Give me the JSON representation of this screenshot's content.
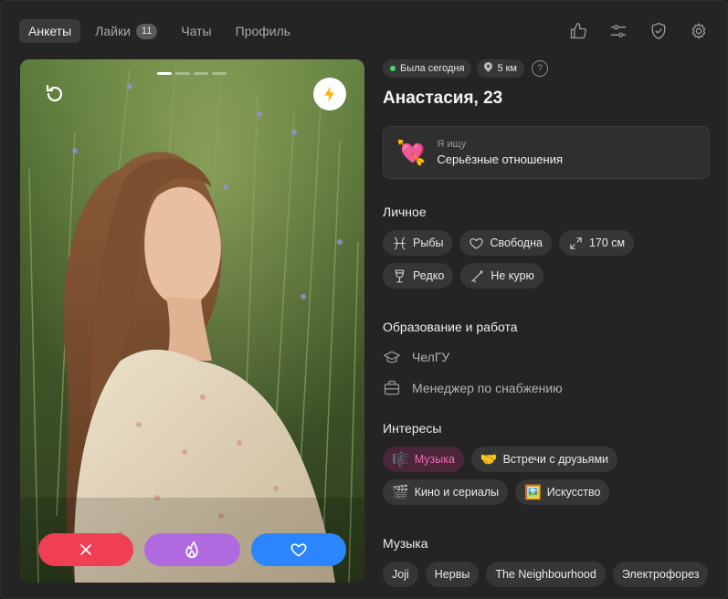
{
  "nav": {
    "tabs": [
      {
        "label": "Анкеты",
        "active": true
      },
      {
        "label": "Лайки",
        "badge": "11"
      },
      {
        "label": "Чаты"
      },
      {
        "label": "Профиль"
      }
    ],
    "icons": [
      "thumbs-up-icon",
      "sliders-icon",
      "shield-check-icon",
      "gear-icon"
    ]
  },
  "photo": {
    "photo_count": 4,
    "current_photo": 1,
    "actions": [
      "dislike",
      "superlike",
      "like"
    ]
  },
  "profile": {
    "status": "Была сегодня",
    "distance": "5 км",
    "help": "?",
    "name": "Анастасия, 23",
    "looking_label": "Я ищу",
    "looking_value": "Серьёзные отношения",
    "looking_emoji": "💘"
  },
  "personal": {
    "title": "Личное",
    "zodiac": "Рыбы",
    "relationship": "Свободна",
    "height": "170 см",
    "drinking": "Редко",
    "smoking": "Не курю"
  },
  "education": {
    "title": "Образование и работа",
    "university": "ЧелГУ",
    "job": "Менеджер по снабжению"
  },
  "interests": {
    "title": "Интересы",
    "items": [
      {
        "emoji": "🎼",
        "label": "Музыка",
        "highlighted": true
      },
      {
        "emoji": "🤝",
        "label": "Встречи с друзьями"
      },
      {
        "emoji": "🎬",
        "label": "Кино и сериалы"
      },
      {
        "emoji": "🖼️",
        "label": "Искусство"
      }
    ]
  },
  "music": {
    "title": "Музыка",
    "items": [
      "Joji",
      "Нервы",
      "The Neighbourhood",
      "Электрофорез"
    ]
  },
  "colors": {
    "dislike": "#f03e55",
    "superlike": "#b06ae0",
    "like": "#2a85ff",
    "online": "#4cd964",
    "accent_chip": "#f06bb8"
  }
}
